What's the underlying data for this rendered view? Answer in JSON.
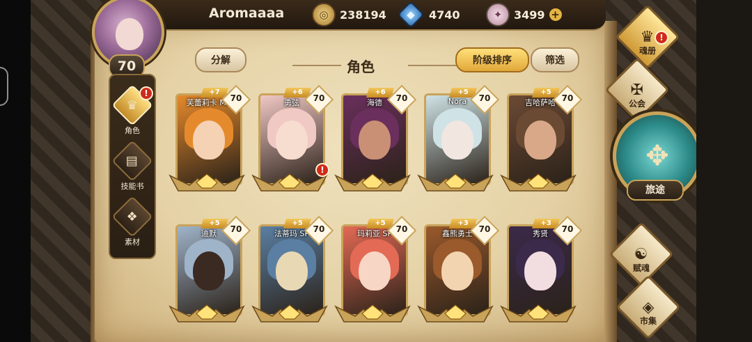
{
  "player": {
    "name": "Aromaaaa",
    "level": "70"
  },
  "resources": [
    {
      "icon": "gold-coin-icon",
      "value": "238194"
    },
    {
      "icon": "blue-gem-icon",
      "value": "4740"
    },
    {
      "icon": "pink-crystal-icon",
      "value": "3499"
    }
  ],
  "left_nav": [
    {
      "label": "角色",
      "icon": "character-icon",
      "active": true,
      "alert": true
    },
    {
      "label": "技能书",
      "icon": "skillbook-icon",
      "active": false,
      "alert": false
    },
    {
      "label": "素材",
      "icon": "material-icon",
      "active": false,
      "alert": false
    }
  ],
  "header": {
    "decompose": "分解",
    "title": "角色",
    "sort": "阶级排序",
    "filter": "筛选"
  },
  "alert_mark": "!",
  "characters": [
    {
      "name": "芙蕾莉卡 MZ",
      "plus": "+7",
      "level": "70",
      "alert": false,
      "palette": [
        "#e58a2c",
        "#f6d2b4"
      ]
    },
    {
      "name": "勇弦",
      "plus": "+6",
      "level": "70",
      "alert": true,
      "palette": [
        "#f0c8c4",
        "#f7dcd0"
      ]
    },
    {
      "name": "海德",
      "plus": "+6",
      "level": "70",
      "alert": false,
      "palette": [
        "#6a2f5c",
        "#c99075"
      ]
    },
    {
      "name": "Nora",
      "plus": "+5",
      "level": "70",
      "alert": false,
      "palette": [
        "#cfe3e6",
        "#f2e6e0"
      ]
    },
    {
      "name": "吉哈萨哈",
      "plus": "+5",
      "level": "70",
      "alert": false,
      "palette": [
        "#6b4a34",
        "#d8a889"
      ]
    },
    {
      "name": "迪默",
      "plus": "+5",
      "level": "70",
      "alert": false,
      "palette": [
        "#9fb3c9",
        "#3b2a22"
      ]
    },
    {
      "name": "法蒂玛 SP",
      "plus": "+5",
      "level": "70",
      "alert": false,
      "palette": [
        "#5b7fa2",
        "#e9d8b4"
      ]
    },
    {
      "name": "玛莉亚 SP",
      "plus": "+5",
      "level": "70",
      "alert": false,
      "palette": [
        "#e36a55",
        "#f7d6c6"
      ]
    },
    {
      "name": "鑫熊勇士",
      "plus": "+3",
      "level": "70",
      "alert": false,
      "palette": [
        "#9a5a2c",
        "#f3d4b0"
      ]
    },
    {
      "name": "秀贤",
      "plus": "+3",
      "level": "70",
      "alert": false,
      "palette": [
        "#3b2a4a",
        "#f2dde0"
      ]
    }
  ],
  "right_menu": [
    {
      "label": "魂册",
      "icon": "soul-book-icon",
      "alert": true
    },
    {
      "label": "公会",
      "icon": "guild-icon",
      "alert": false
    },
    {
      "label": "旅途",
      "icon": "journey-icon",
      "alert": false
    },
    {
      "label": "赋魂",
      "icon": "soul-empower-icon",
      "alert": false
    },
    {
      "label": "市集",
      "icon": "market-icon",
      "alert": false
    }
  ],
  "colors": {
    "gold_border": "#c9a35a",
    "parchment": "#e5d2a6",
    "alert_red": "#d02a1a",
    "active_tab": "#e1a83a"
  }
}
